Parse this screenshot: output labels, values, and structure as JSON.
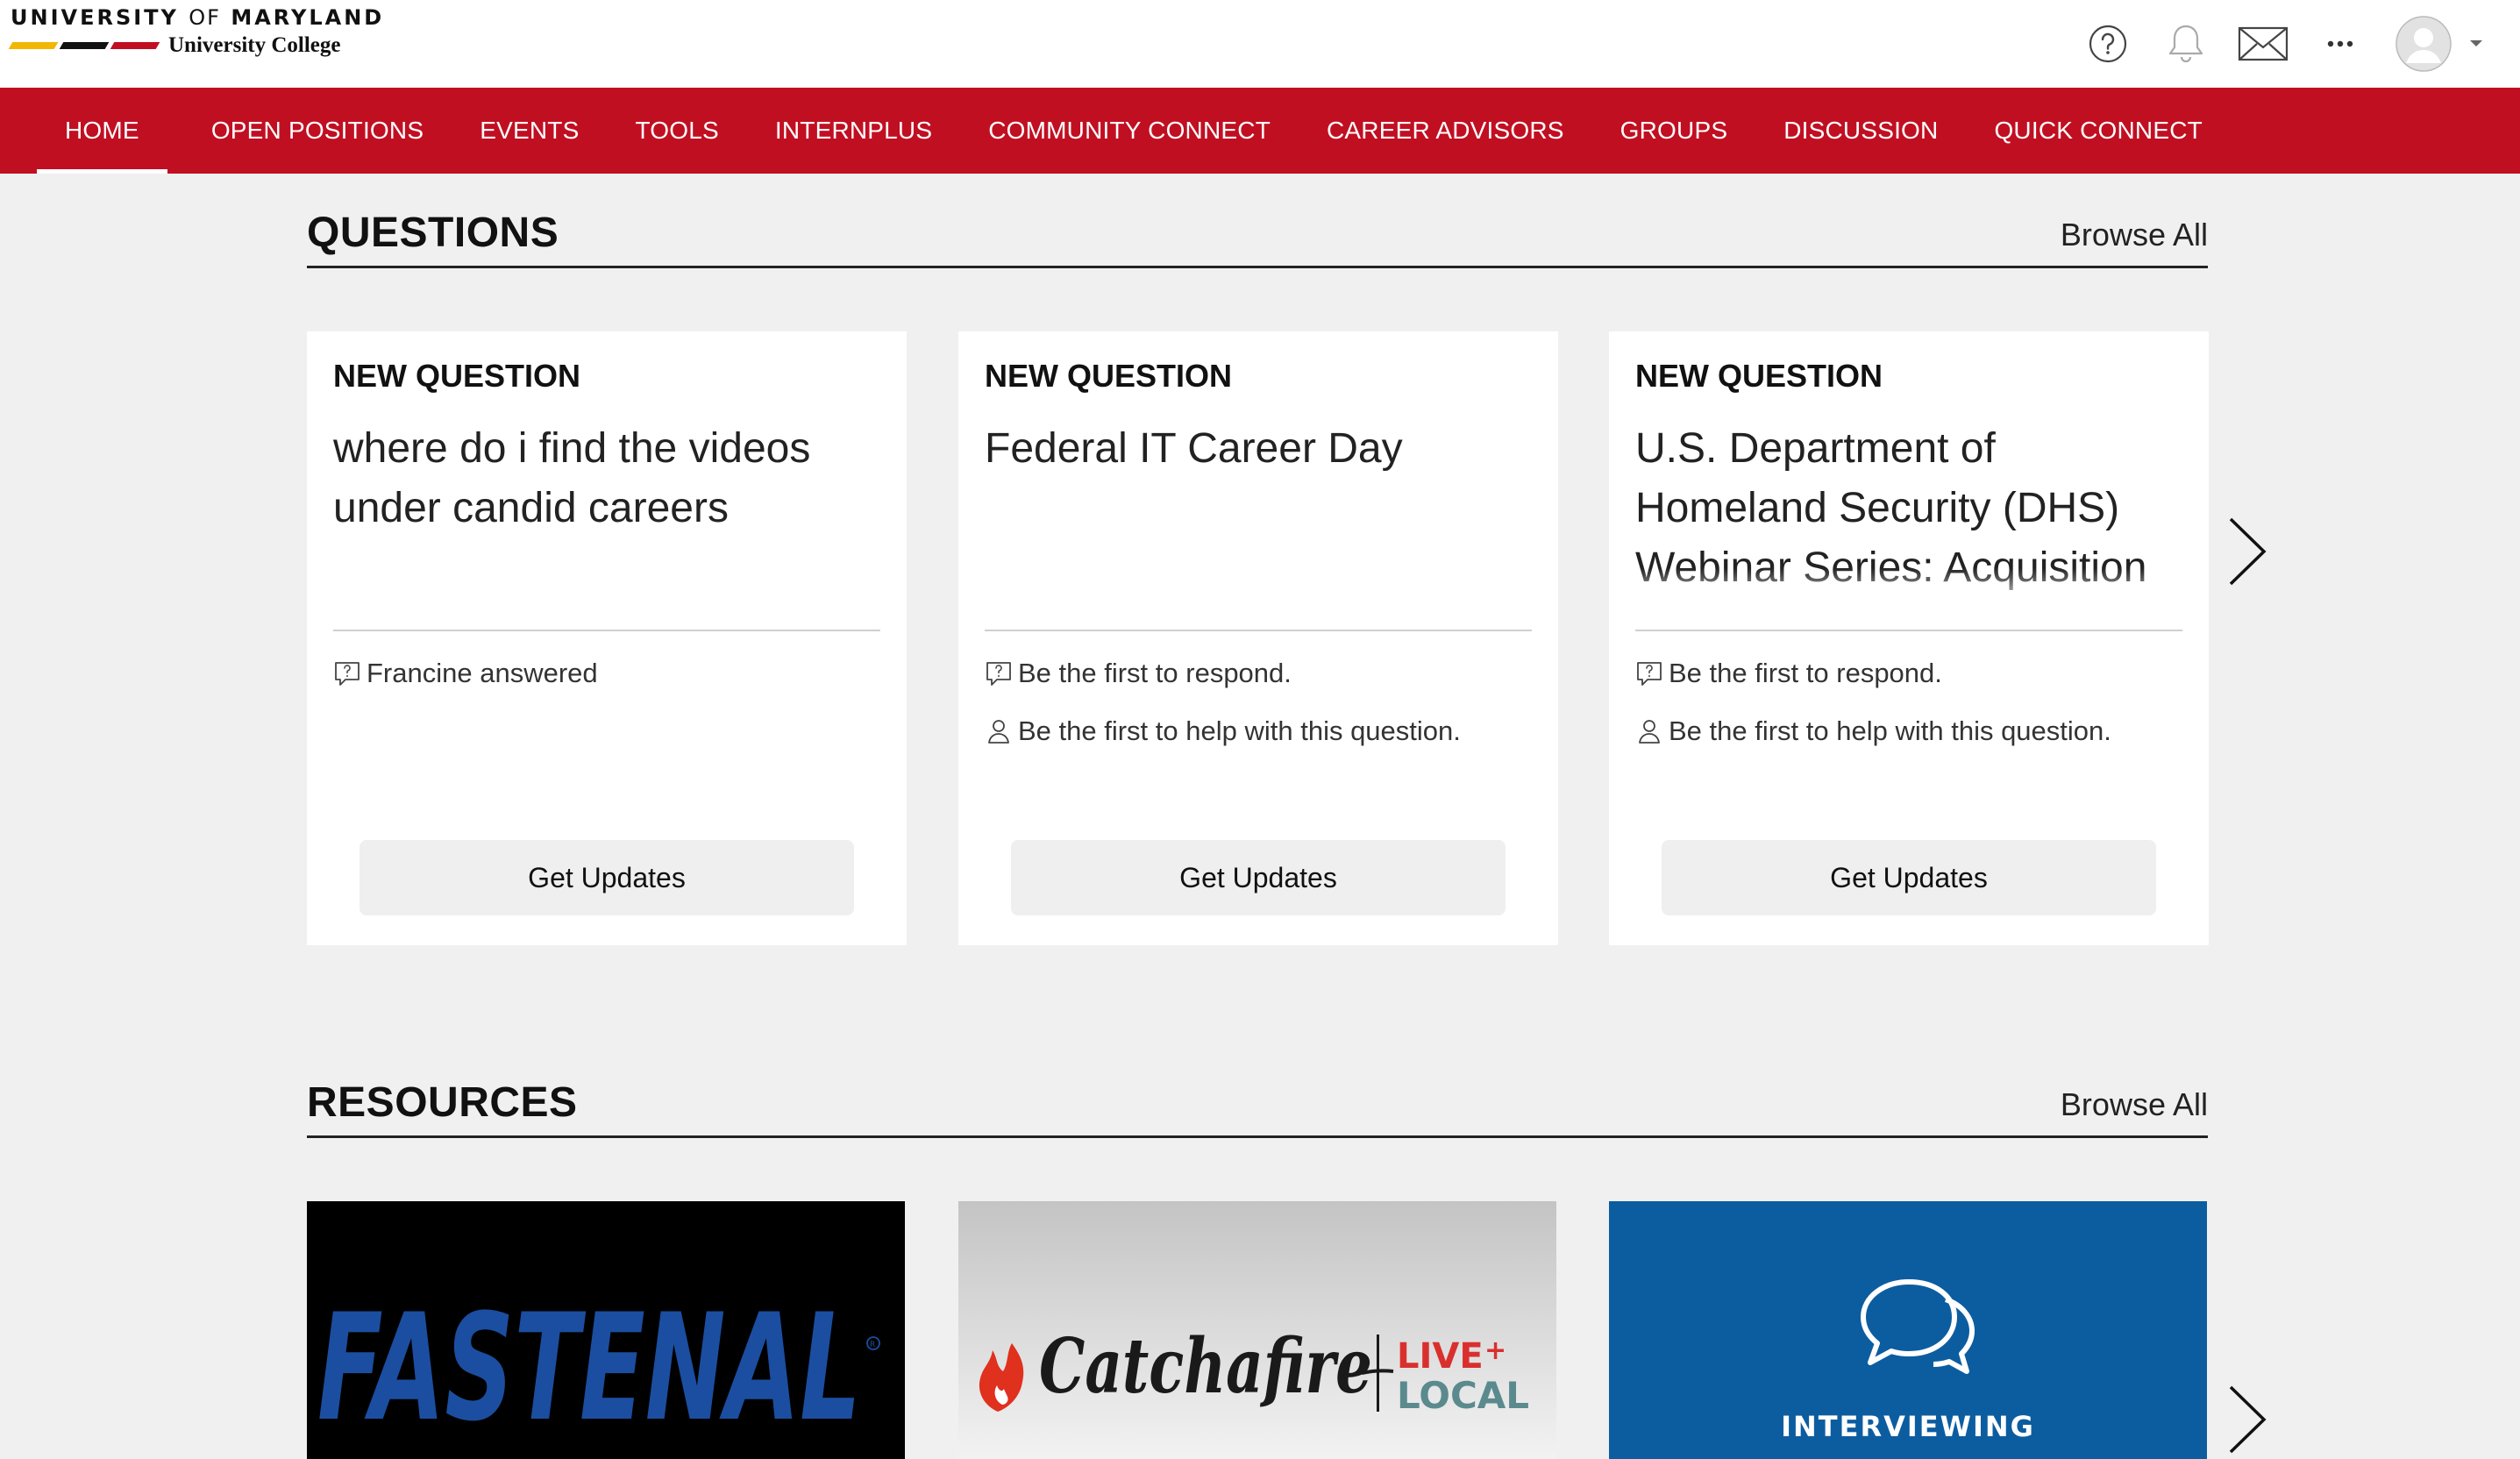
{
  "header": {
    "logo_line1_a": "UNIVERSITY",
    "logo_line1_b": "OF",
    "logo_line1_c": "MARYLAND",
    "logo_line2": "University College",
    "logo_colors": [
      "#f2b705",
      "#111111",
      "#c10f22"
    ],
    "icons": [
      "help-icon",
      "bell-icon",
      "mail-icon",
      "more-icon",
      "avatar",
      "chevron-down-icon"
    ]
  },
  "nav": {
    "items": [
      {
        "label": "HOME",
        "active": true
      },
      {
        "label": "OPEN POSITIONS"
      },
      {
        "label": "EVENTS"
      },
      {
        "label": "TOOLS"
      },
      {
        "label": "INTERNPLUS"
      },
      {
        "label": "COMMUNITY CONNECT"
      },
      {
        "label": "CAREER ADVISORS"
      },
      {
        "label": "GROUPS"
      },
      {
        "label": "DISCUSSION"
      },
      {
        "label": "QUICK CONNECT"
      }
    ],
    "color": "#c10f22"
  },
  "questions": {
    "title": "QUESTIONS",
    "browse_all": "Browse All",
    "cards": [
      {
        "label": "NEW QUESTION",
        "title": "where do i find the videos under candid careers",
        "meta1": "Francine answered",
        "button": "Get Updates"
      },
      {
        "label": "NEW QUESTION",
        "title": "Federal IT Career Day",
        "meta1": "Be the first to respond.",
        "meta2": "Be the first to help with this question.",
        "button": "Get Updates"
      },
      {
        "label": "NEW QUESTION",
        "title": "U.S. Department of Homeland Security (DHS) Webinar Series: Acquisition Professional: Procurement",
        "meta1": "Be the first to respond.",
        "meta2": "Be the first to help with this question.",
        "button": "Get Updates"
      }
    ]
  },
  "resources": {
    "title": "RESOURCES",
    "browse_all": "Browse All",
    "cards": [
      {
        "brand": "FASTENAL",
        "bg": "#000000",
        "fg": "#1b4ea0"
      },
      {
        "brand": "Catchafire",
        "tag_line1": "LIVE",
        "tag_line2": "LOCAL",
        "bg": "#d9d9d9"
      },
      {
        "label": "INTERVIEWING",
        "icon": "chat-bubbles-icon",
        "bg": "#0c5da0"
      }
    ]
  }
}
